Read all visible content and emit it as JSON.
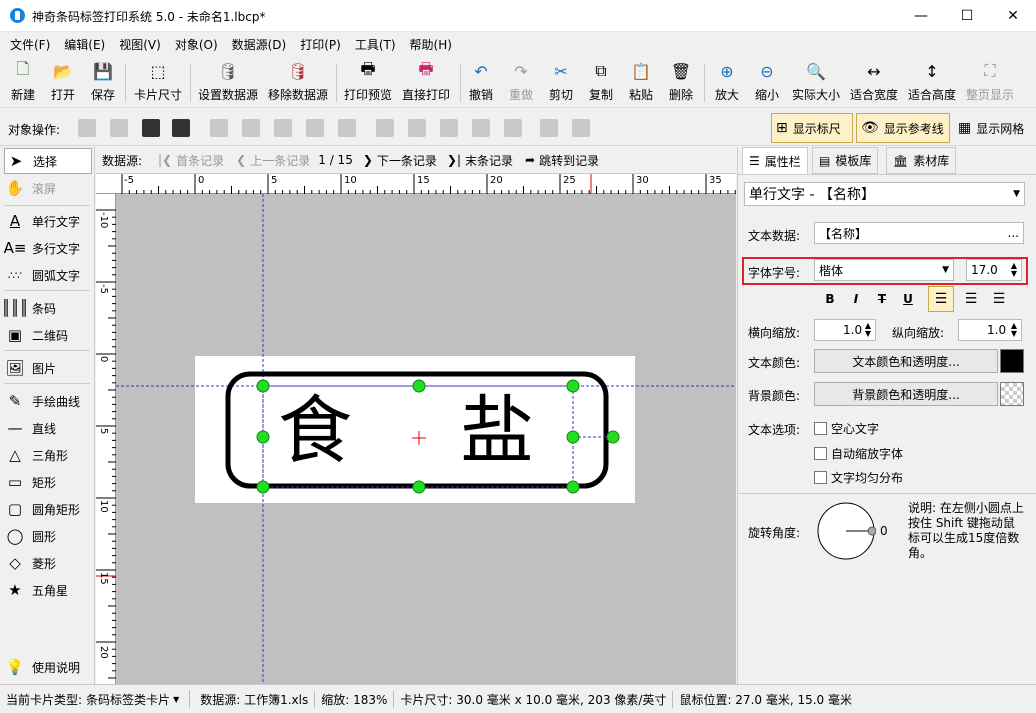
{
  "window": {
    "title": "神奇条码标签打印系统 5.0 - 未命名1.lbcp*",
    "minimize": "—",
    "maximize": "☐",
    "close": "✕"
  },
  "menu": [
    "文件(F)",
    "编辑(E)",
    "视图(V)",
    "对象(O)",
    "数据源(D)",
    "打印(P)",
    "工具(T)",
    "帮助(H)"
  ],
  "toolbar": {
    "new": "新建",
    "open": "打开",
    "save": "保存",
    "card_size": "卡片尺寸",
    "set_datasource": "设置数据源",
    "remove_datasource": "移除数据源",
    "print_preview": "打印预览",
    "direct_print": "直接打印",
    "undo": "撤销",
    "redo": "重做",
    "cut": "剪切",
    "copy": "复制",
    "paste": "粘贴",
    "delete": "删除",
    "zoom_in": "放大",
    "zoom_out": "缩小",
    "actual_size": "实际大小",
    "fit_width": "适合宽度",
    "fit_height": "适合高度",
    "full_page": "整页显示"
  },
  "objbar": {
    "label": "对象操作:",
    "show_ruler": "显示标尺",
    "show_guides": "显示参考线",
    "show_grid": "显示网格"
  },
  "tools": {
    "select": "选择",
    "scroll": "滚屏",
    "single_text": "单行文字",
    "multi_text": "多行文字",
    "arc_text": "圆弧文字",
    "barcode": "条码",
    "qrcode": "二维码",
    "image": "图片",
    "freehand": "手绘曲线",
    "line": "直线",
    "triangle": "三角形",
    "rect": "矩形",
    "round_rect": "圆角矩形",
    "circle": "圆形",
    "diamond": "菱形",
    "star": "五角星",
    "help": "使用说明"
  },
  "nav": {
    "datasource_label": "数据源:",
    "first": "首条记录",
    "prev": "上一条记录",
    "position": "1 / 15",
    "next": "下一条记录",
    "last": "末条记录",
    "jump": "跳转到记录"
  },
  "ruler": {
    "h_ticks": [
      "-5",
      "0",
      "5",
      "10",
      "15",
      "20",
      "25",
      "30",
      "35"
    ],
    "v_ticks": [
      "-10",
      "-5",
      "0",
      "5",
      "10",
      "15",
      "20"
    ]
  },
  "label": {
    "char1": "食",
    "char2": "盐"
  },
  "panel": {
    "tabs": [
      "属性栏",
      "模板库",
      "素材库"
    ],
    "object_select": "单行文字 - 【名称】",
    "text_data_label": "文本数据:",
    "text_data_value": "【名称】",
    "text_data_btn": "...",
    "font_label": "字体字号:",
    "font_value": "楷体",
    "font_size": "17.0",
    "style_buttons": [
      "B",
      "I",
      "T",
      "U"
    ],
    "hscale_label": "横向缩放:",
    "hscale": "1.0",
    "vscale_label": "纵向缩放:",
    "vscale": "1.0",
    "text_color_label": "文本颜色:",
    "text_color_btn": "文本颜色和透明度...",
    "bg_color_label": "背景颜色:",
    "bg_color_btn": "背景颜色和透明度...",
    "options_label": "文本选项:",
    "opt_hollow": "空心文字",
    "opt_autoscale": "自动缩放字体",
    "opt_even": "文字均匀分布",
    "rotate_label": "旋转角度:",
    "rotate_value": "0",
    "note": "说明: 在左侧小圆点上按住 Shift 键拖动鼠标可以生成15度倍数角。"
  },
  "status": {
    "card_type_label": "当前卡片类型:",
    "card_type": "条码标签类卡片",
    "datasource": "数据源: 工作簿1.xls",
    "zoom": "缩放: 183%",
    "card_size": "卡片尺寸: 30.0 毫米 x 10.0 毫米, 203 像素/英寸",
    "mouse": "鼠标位置: 27.0 毫米, 15.0 毫米"
  },
  "colors": {
    "accent": "#1e7fd8",
    "handle": "#22dd22",
    "highlight_border": "#d9232d",
    "text_color": "#000000"
  }
}
